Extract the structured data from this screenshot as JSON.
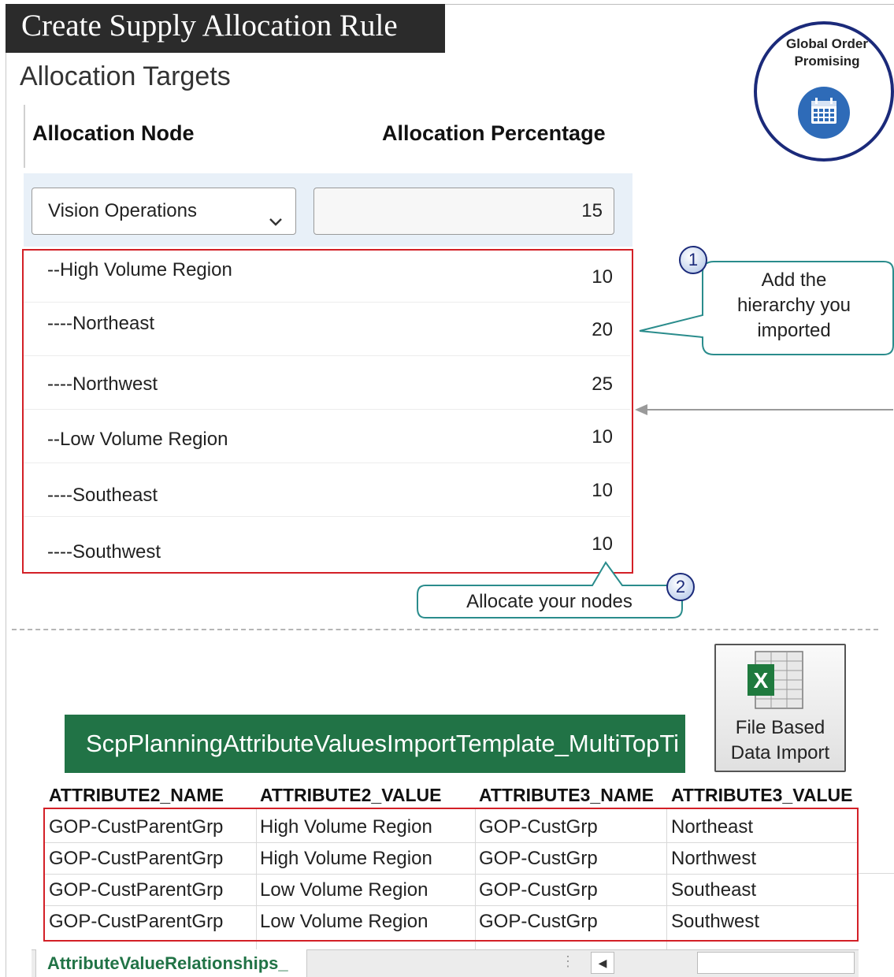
{
  "page": {
    "title": "Create Supply Allocation Rule",
    "section_title": "Allocation Targets"
  },
  "table": {
    "col_node": "Allocation Node",
    "col_percentage": "Allocation Percentage",
    "selected_node": "Vision Operations",
    "selected_percentage": "15",
    "rows": [
      {
        "label": "--High  Volume  Region",
        "value": "10"
      },
      {
        "label": "----Northeast",
        "value": "20"
      },
      {
        "label": "----Northwest",
        "value": "25"
      },
      {
        "label": "--Low  Volume  Region",
        "value": "10"
      },
      {
        "label": "----Southeast",
        "value": "10"
      },
      {
        "label": "----Southwest",
        "value": "10"
      }
    ]
  },
  "badge": {
    "line1": "Global Order",
    "line2": "Promising",
    "icon": "calendar-icon",
    "ring_color": "#1b2a7a",
    "icon_bg": "#2e6bb8"
  },
  "callouts": {
    "c1_number": "1",
    "c1_line1": "Add the",
    "c1_line2": "hierarchy  you",
    "c1_line3": "imported",
    "c2_number": "2",
    "c2_text": "Allocate your nodes"
  },
  "import_tile": {
    "line1": "File Based",
    "line2": "Data Import",
    "icon": "excel-icon"
  },
  "spreadsheet": {
    "banner": "ScpPlanningAttributeValuesImportTemplate_MultiTopTi",
    "headers": [
      "ATTRIBUTE2_NAME",
      "ATTRIBUTE2_VALUE",
      "ATTRIBUTE3_NAME",
      "ATTRIBUTE3_VALUE"
    ],
    "rows": [
      [
        "GOP-CustParentGrp",
        "High Volume Region",
        "GOP-CustGrp",
        "Northeast"
      ],
      [
        "GOP-CustParentGrp",
        "High Volume Region",
        "GOP-CustGrp",
        "Northwest"
      ],
      [
        "GOP-CustParentGrp",
        "Low Volume Region",
        "GOP-CustGrp",
        "Southeast"
      ],
      [
        "GOP-CustParentGrp",
        "Low Volume Region",
        "GOP-CustGrp",
        "Southwest"
      ]
    ],
    "sheet_tab": "AttributeValueRelationships_",
    "tab_dots": "⋮",
    "scroll_left": "◀"
  },
  "colors": {
    "highlight_red": "#d32027",
    "excel_green": "#217346",
    "selection_band": "#e8f0f8"
  }
}
